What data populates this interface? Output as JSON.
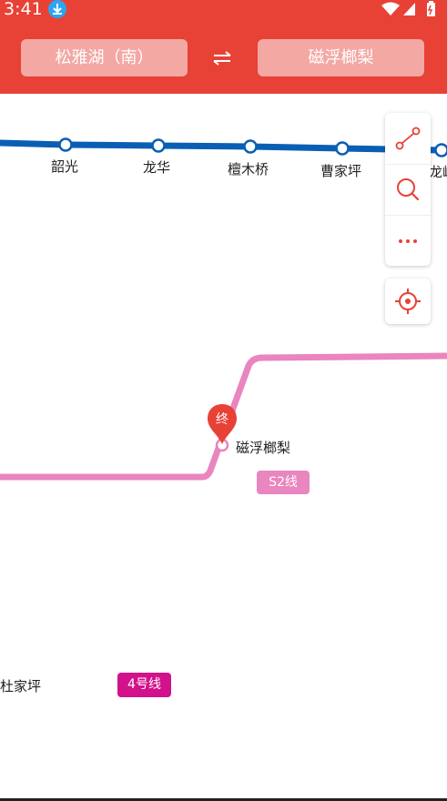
{
  "status_bar": {
    "time": "3:41"
  },
  "header": {
    "from_station": "松雅湖（南）",
    "to_station": "磁浮榔梨",
    "swap_glyph": "⇆"
  },
  "map": {
    "stations_line_top": [
      "韶光",
      "龙华",
      "檀木桥",
      "曹家坪",
      "龙岭"
    ],
    "destination_station": "磁浮榔梨",
    "destination_marker": "终",
    "other_station": "杜家坪",
    "line_badges": {
      "s2": "S2线",
      "line4": "4号线"
    }
  },
  "colors": {
    "header": "#e84136",
    "line_blue": "#0a5fb4",
    "line_pink": "#e985bf",
    "line4": "#d1128a",
    "accent": "#e84136"
  },
  "icons": {
    "route": "route-icon",
    "search": "search-icon",
    "more": "more-icon",
    "locate": "locate-icon"
  }
}
